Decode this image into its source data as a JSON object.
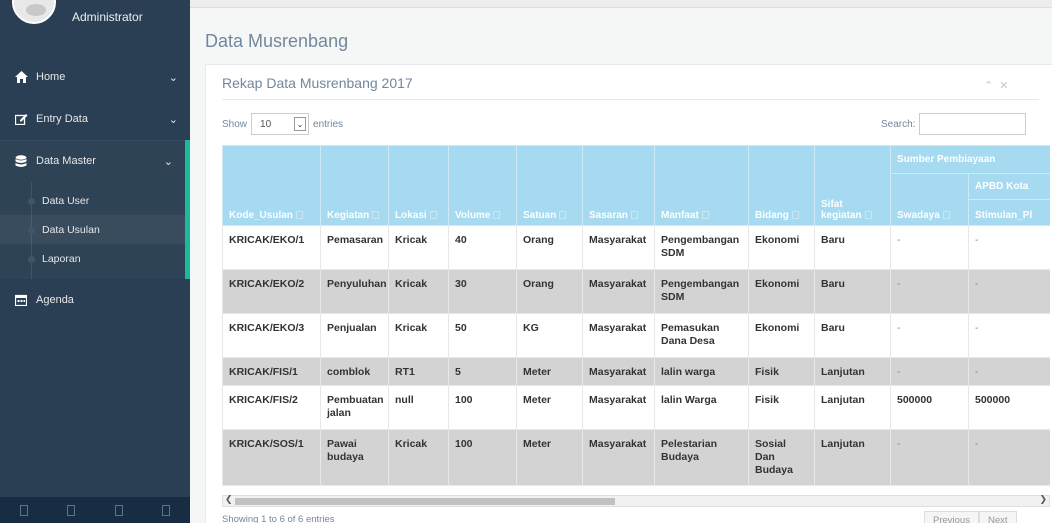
{
  "sidebar": {
    "profile_name": "Administrator",
    "items": [
      {
        "label": "Home",
        "icon": "home-icon"
      },
      {
        "label": "Entry Data",
        "icon": "edit-icon"
      },
      {
        "label": "Data Master",
        "icon": "database-icon"
      },
      {
        "label": "Agenda",
        "icon": "calendar-icon"
      }
    ],
    "subitems": [
      {
        "label": "Data User"
      },
      {
        "label": "Data Usulan"
      },
      {
        "label": "Laporan"
      }
    ],
    "active_color": "#1abb9c"
  },
  "page": {
    "title": "Data Musrenbang",
    "panel_title": "Rekap Data Musrenbang 2017"
  },
  "controls": {
    "show_label": "Show",
    "entries_value": "10",
    "entries_label": "entries",
    "search_label": "Search:",
    "search_value": ""
  },
  "table": {
    "group_header_1": "Sumber Pembiayaan",
    "group_header_2": "APBD Kota",
    "columns": [
      "Kode_Usulan",
      "Kegiatan",
      "Lokasi",
      "Volume",
      "Satuan",
      "Sasaran",
      "Manfaat",
      "Bidang",
      "Sifat kegiatan",
      "Swadaya",
      "Stimulan_Pl"
    ],
    "rows": [
      [
        "KRICAK/EKO/1",
        "Pemasaran",
        "Kricak",
        "40",
        "Orang",
        "Masyarakat",
        "Pengembangan SDM",
        "Ekonomi",
        "Baru",
        "-",
        "-"
      ],
      [
        "KRICAK/EKO/2",
        "Penyuluhan",
        "Kricak",
        "30",
        "Orang",
        "Masyarakat",
        "Pengembangan SDM",
        "Ekonomi",
        "Baru",
        "-",
        "-"
      ],
      [
        "KRICAK/EKO/3",
        "Penjualan",
        "Kricak",
        "50",
        "KG",
        "Masyarakat",
        "Pemasukan Dana Desa",
        "Ekonomi",
        "Baru",
        "-",
        "-"
      ],
      [
        "KRICAK/FIS/1",
        "comblok",
        "RT1",
        "5",
        "Meter",
        "Masyarakat",
        "lalin warga",
        "Fisik",
        "Lanjutan",
        "-",
        "-"
      ],
      [
        "KRICAK/FIS/2",
        "Pembuatan jalan",
        "null",
        "100",
        "Meter",
        "Masyarakat",
        "lalin Warga",
        "Fisik",
        "Lanjutan",
        "500000",
        "500000"
      ],
      [
        "KRICAK/SOS/1",
        "Pawai budaya",
        "Kricak",
        "100",
        "Meter",
        "Masyarakat",
        "Pelestarian Budaya",
        "Sosial Dan Budaya",
        "Lanjutan",
        "-",
        "-"
      ]
    ],
    "header_color": "#a5daf0"
  },
  "footer": {
    "info": "Showing 1 to 6 of 6 entries",
    "previous": "Previous",
    "next": "Next"
  }
}
